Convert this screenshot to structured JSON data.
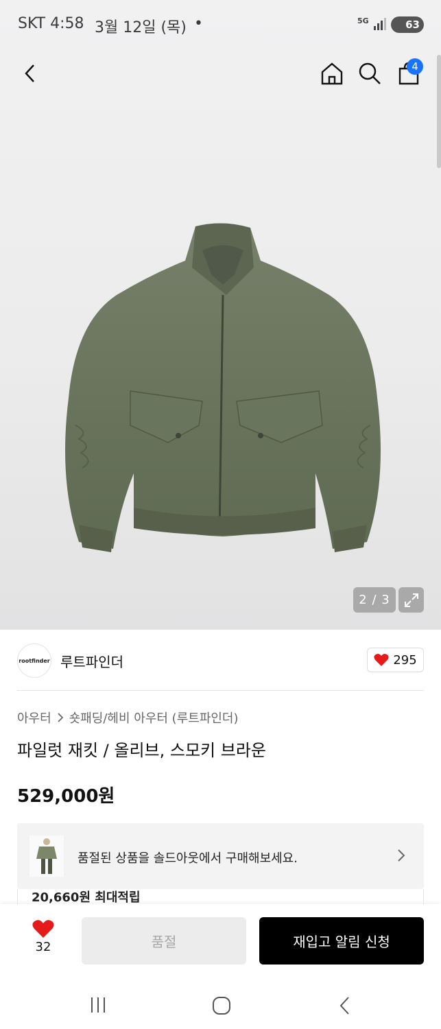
{
  "status_bar": {
    "carrier_time": "SKT 4:58",
    "date": "3월 12일 (목)",
    "dot": "•",
    "network": "5G",
    "battery": "63"
  },
  "top_nav": {
    "back_icon": "chevron-left-icon",
    "home_icon": "home-icon",
    "search_icon": "search-icon",
    "cart_icon": "shopping-bag-icon",
    "cart_badge": "4"
  },
  "gallery": {
    "counter": "2 / 3",
    "expand_icon": "expand-icon",
    "product_color": "#6f7a5f"
  },
  "brand": {
    "logo_text": "rootfinder",
    "name": "루트파인더",
    "like_count": "295"
  },
  "product": {
    "breadcrumb": [
      "아우터",
      "숏패딩/헤비 아우터 (루트파인더)"
    ],
    "title": "파일럿 재킷 / 올리브, 스모키 브라운",
    "price": "529,000원"
  },
  "soldout_banner": {
    "text": "품절된 상품을 솔드아웃에서 구매해보세요."
  },
  "points_peek": {
    "text": "20,660원 최대적립"
  },
  "bottom_bar": {
    "wish_count": "32",
    "soldout_label": "품절",
    "restock_label": "재입고 알림 신청"
  },
  "colors": {
    "accent_blue": "#1a73ff",
    "heart_red": "#e51b1b",
    "primary_button": "#000000"
  }
}
